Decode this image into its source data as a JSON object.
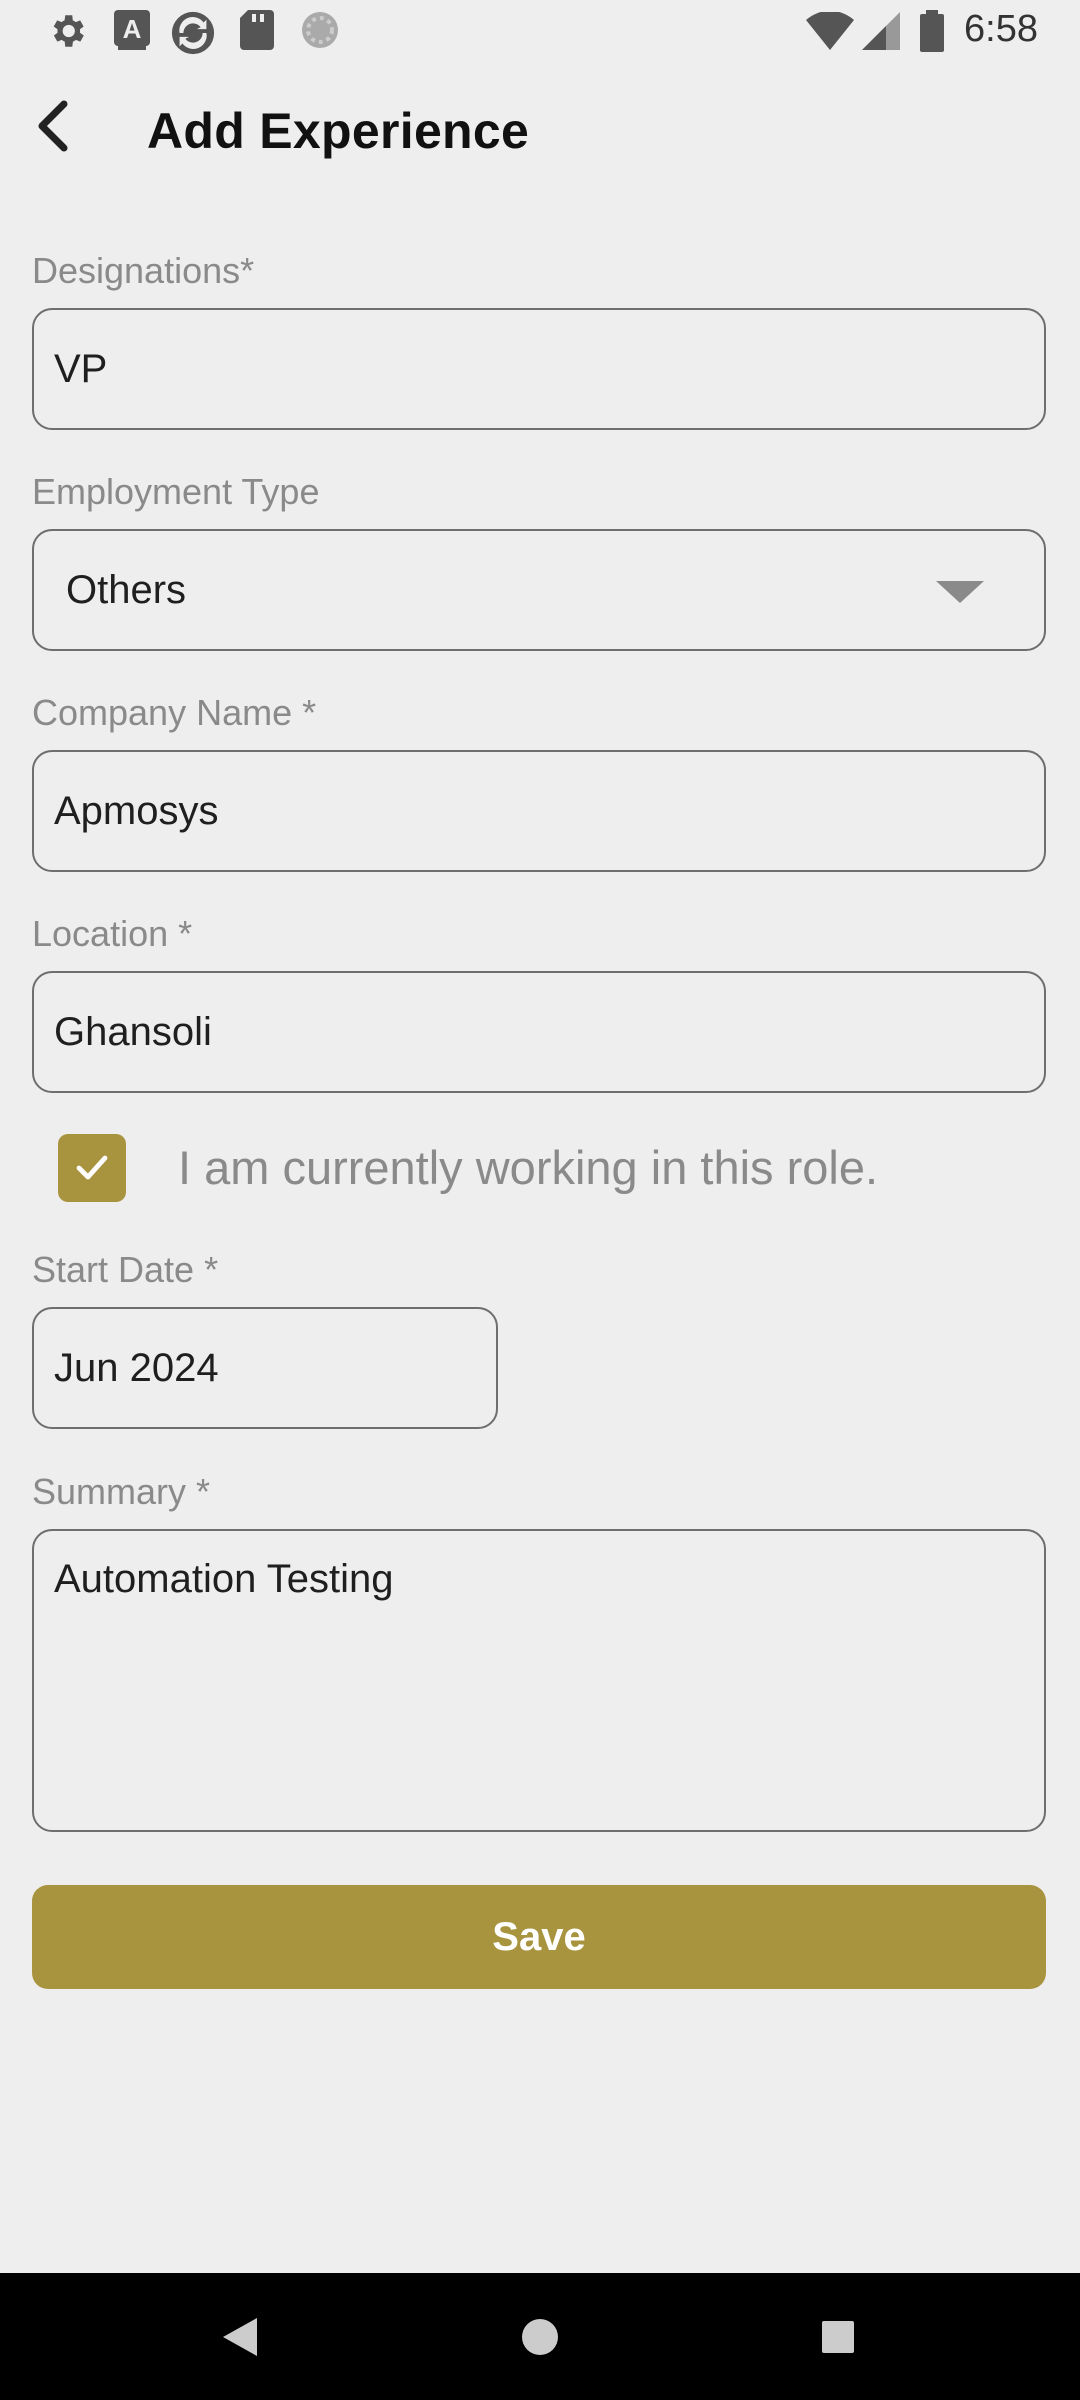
{
  "status_bar": {
    "time": "6:58",
    "left_icons": [
      "settings-icon",
      "font-a-icon",
      "sync-app-icon",
      "sd-card-icon",
      "loading-circle-icon"
    ],
    "right_icons": [
      "wifi-icon",
      "cellular-signal-icon",
      "battery-icon"
    ]
  },
  "header": {
    "title": "Add Experience"
  },
  "form": {
    "designation": {
      "label": "Designations*",
      "value": "VP"
    },
    "employment_type": {
      "label": "Employment Type",
      "value": "Others"
    },
    "company_name": {
      "label": "Company Name *",
      "value": "Apmosys"
    },
    "location": {
      "label": "Location *",
      "value": "Ghansoli"
    },
    "currently_working": {
      "label": "I am currently working in this role.",
      "checked": true
    },
    "start_date": {
      "label": "Start Date *",
      "value": "Jun 2024"
    },
    "summary": {
      "label": "Summary *",
      "value": "Automation Testing"
    },
    "save_label": "Save"
  },
  "colors": {
    "accent": "#a8933f",
    "background": "#eeeeee",
    "label": "#8a8a8a"
  }
}
